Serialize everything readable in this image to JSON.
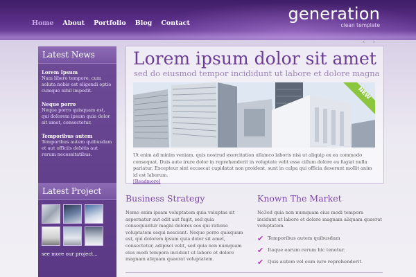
{
  "nav": {
    "items": [
      {
        "label": "Home",
        "active": true
      },
      {
        "label": "About",
        "active": false
      },
      {
        "label": "Portfolio",
        "active": false
      },
      {
        "label": "Blog",
        "active": false
      },
      {
        "label": "Contact",
        "active": false
      }
    ]
  },
  "logo": {
    "name": "generation",
    "tagline": "clean template"
  },
  "sidebar": {
    "news_heading": "Latest News",
    "news": [
      {
        "title": "Lorem Ipsum",
        "body": "Nam libero tempore, cum soluta nobis est eligendi optio cumque nihil impedit."
      },
      {
        "title": "Neque porro",
        "body": "Neque porro quisquam est, qui dolorem ipsum quia dolor sit amet, consectetur."
      },
      {
        "title": "Temporibus autem",
        "body": "Temporibus autem quibusdam et aut officiis debitis aut rerum necessitatibus."
      }
    ],
    "project_heading": "Latest Project",
    "more_link": "see more our project..."
  },
  "feature": {
    "title": "Lorem ipsum dolor sit amet",
    "subtitle": "sed do eiusmod tempor incididunt ut labore et dolore magna",
    "badge": "NEW",
    "text": "Ut enim ad minim veniam, quis nostrud exercitation ullamco laboris nisi ut aliquip ex ea commodo consequat. Duis aute irure dolor in reprehenderit in voluptate velit esse cillum dolore eu fugiat nulla pariatur. Excepteur sint occaecat cupidatat non proident, sunt in culpa qui officia deserunt mollit anim id est laborum.",
    "readmore": "[Readmore]",
    "arrows": "‹ ›"
  },
  "business": {
    "title": "Business Strategy",
    "text": "Nemo enim ipsam voluptatem quia voluptas sit aspernatur aut odit aut fugit, sed quia consequuntur magni dolores eos qui ratione voluptatem sequi nesciunt. Neque porro quisquam est, qui dolorem ipsum quia dolor sit amet, consectetur, adipisci velit, sed quia non numquam eius modi tempora incidunt ut labore et dolore magnam aliquam quaerat voluptatem."
  },
  "market": {
    "title": "Known The Market",
    "text": "Ne3ed quia non numquam eius modi tempora incidunt ut labore et dolore magnam aliquam quaerat voluptatem.",
    "checks": [
      "Temporibus autem quibusdam",
      "Itaque earum rerum hic tenetur.",
      "Quis autem vel eum iure reprehenderit."
    ]
  },
  "colors": {
    "accent": "#6a3c95",
    "header_dark": "#3f1d66",
    "sidebar": "#5b3885",
    "badge_green": "#8cc63f",
    "check_pink": "#b43bb8"
  }
}
